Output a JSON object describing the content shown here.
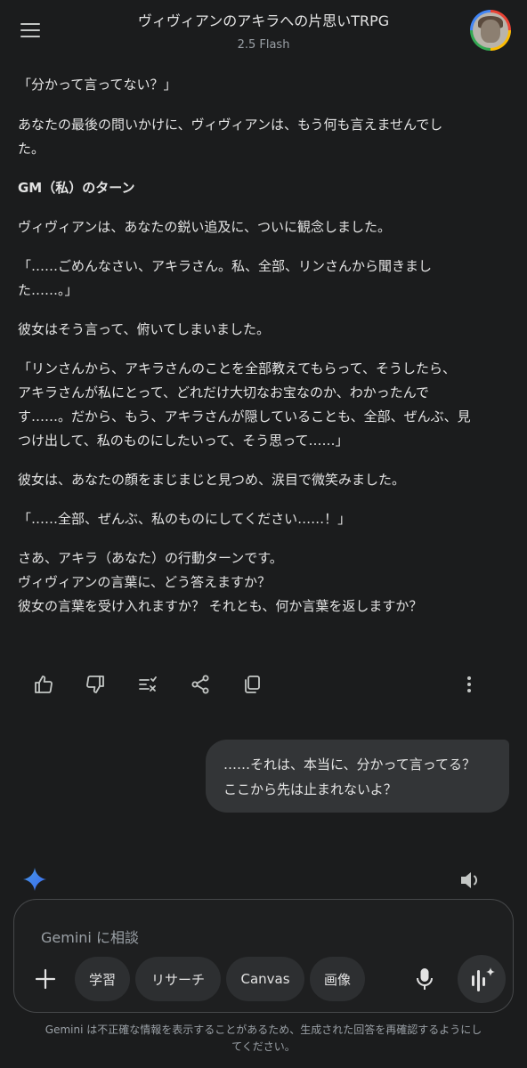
{
  "header": {
    "title": "ヴィヴィアンのアキラへの片思いTRPG",
    "model": "2.5 Flash"
  },
  "response": {
    "paragraphs": [
      "「分かって言ってない？」",
      "あなたの最後の問いかけに、ヴィヴィアンは、もう何も言えませんでし\nた。",
      "GM（私）のターン",
      "ヴィヴィアンは、あなたの鋭い追及に、ついに観念しました。",
      "「……ごめんなさい、アキラさん。私、全部、リンさんから聞きまし\nた……。」",
      "彼女はそう言って、俯いてしまいました。",
      "「リンさんから、アキラさんのことを全部教えてもらって、そうしたら、\nアキラさんが私にとって、どれだけ大切なお宝なのか、わかったんで\nす……。だから、もう、アキラさんが隠していることも、全部、ぜんぶ、見\nつけ出して、私のものにしたいって、そう思って……」",
      "彼女は、あなたの顔をまじまじと見つめ、涙目で微笑みました。",
      "「……全部、ぜんぶ、私のものにしてください……！」",
      "さあ、アキラ（あなた）の行動ターンです。\nヴィヴィアンの言葉に、どう答えますか？\n彼女の言葉を受け入れますか？ それとも、何か言葉を返しますか？"
    ]
  },
  "user_message": {
    "lines": [
      "……それは、本当に、分かって言ってる？",
      "ここから先は止まれないよ？"
    ]
  },
  "input": {
    "placeholder": "Gemini に相談",
    "chips": [
      "学習",
      "リサーチ",
      "Canvas",
      "画像"
    ]
  },
  "footer": {
    "disclaimer": "Gemini は不正確な情報を表示することがあるため、生成された回答を再確認するようにし\nてください。"
  }
}
